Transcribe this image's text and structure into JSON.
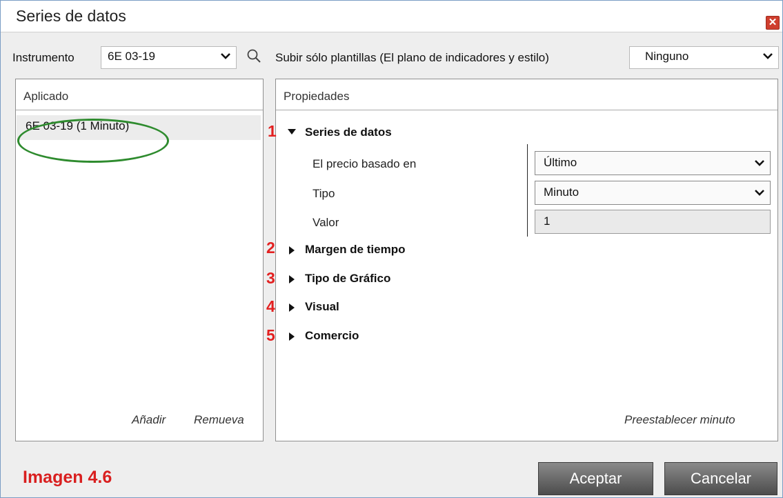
{
  "window": {
    "title": "Series de datos",
    "close_icon": "close-icon"
  },
  "toolbar": {
    "instrument_label": "Instrumento",
    "instrument_value": "6E 03-19",
    "templates_label": "Subir sólo plantillas (El plano de indicadores y estilo)",
    "templates_value": "Ninguno"
  },
  "applied": {
    "header": "Aplicado",
    "items": [
      "6E 03-19 (1 Minuto)"
    ],
    "add_label": "Añadir",
    "remove_label": "Remueva"
  },
  "properties": {
    "header": "Propiedades",
    "sections": [
      {
        "number": "1",
        "label": "Series de datos",
        "expanded": true
      },
      {
        "number": "2",
        "label": "Margen de tiempo",
        "expanded": false
      },
      {
        "number": "3",
        "label": "Tipo de Gráfico",
        "expanded": false
      },
      {
        "number": "4",
        "label": "Visual",
        "expanded": false
      },
      {
        "number": "5",
        "label": "Comercio",
        "expanded": false
      }
    ],
    "fields": [
      {
        "label": "El precio basado en",
        "value": "Último"
      },
      {
        "label": "Tipo",
        "value": "Minuto"
      },
      {
        "label": "Valor",
        "value": "1"
      }
    ],
    "preset_label": "Preestablecer minuto"
  },
  "buttons": {
    "ok": "Aceptar",
    "cancel": "Cancelar"
  },
  "caption": "Imagen 4.6",
  "colors": {
    "annotation_red": "#e32020",
    "highlight_green": "#2e8b2e"
  }
}
